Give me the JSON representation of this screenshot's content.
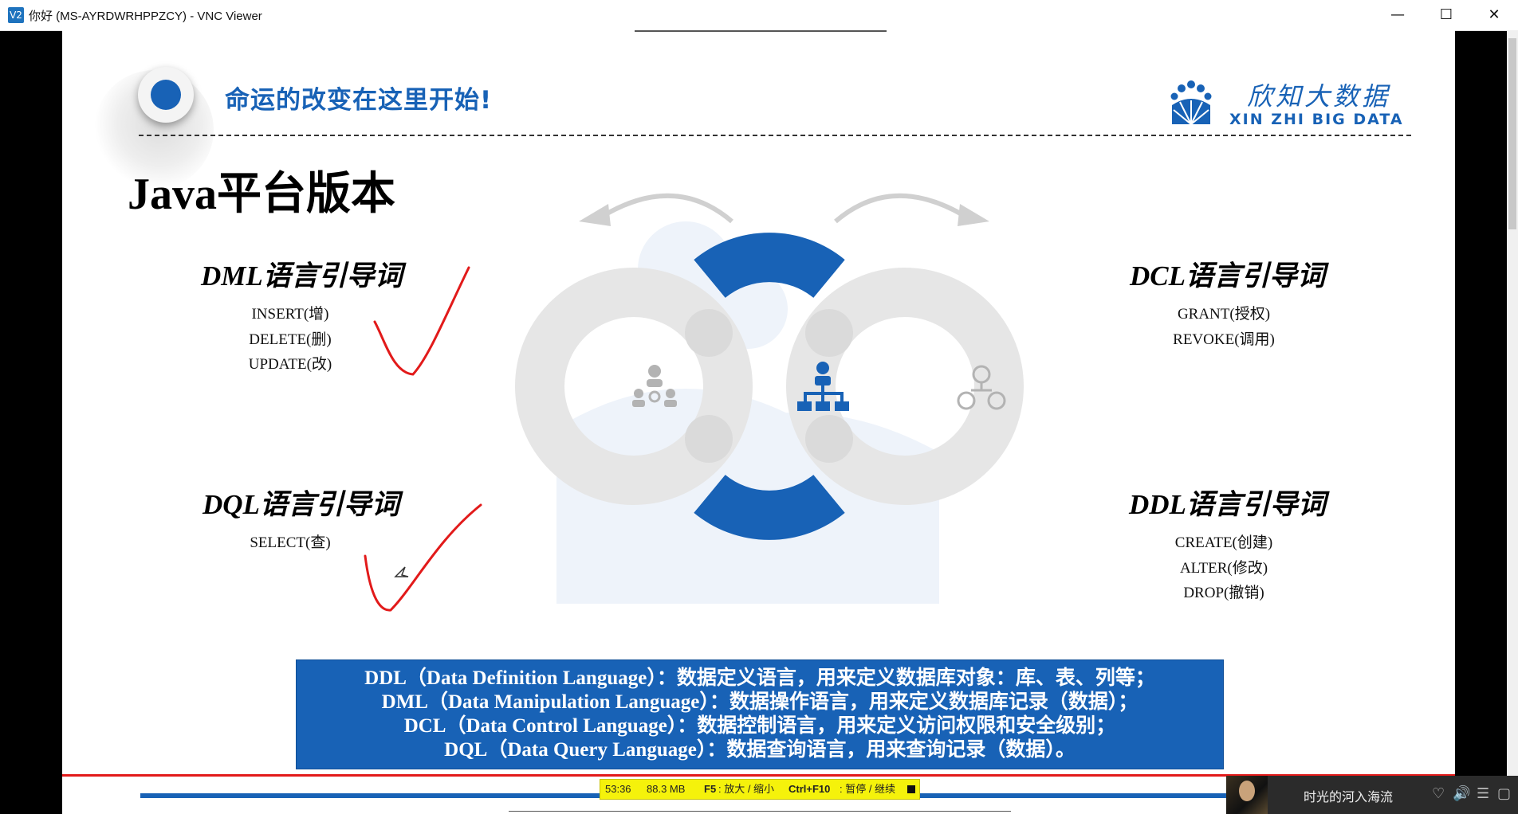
{
  "window": {
    "title": "你好 (MS-AYRDWRHPPZCY) - VNC Viewer",
    "app_icon": "V2",
    "minimize": "—",
    "maximize": "☐",
    "close": "✕"
  },
  "slide": {
    "slogan": "命运的改变在这里开始!",
    "brand_cn": "欣知大数据",
    "brand_en": "XIN ZHI BIG DATA",
    "title": "Java平台版本",
    "dml": {
      "heading": "DML语言引导词",
      "items": [
        "INSERT(增)",
        "DELETE(删)",
        "UPDATE(改)"
      ]
    },
    "dcl": {
      "heading": "DCL语言引导词",
      "items": [
        "GRANT(授权)",
        "REVOKE(调用)"
      ]
    },
    "dql": {
      "heading": "DQL语言引导词",
      "items": [
        "SELECT(查)"
      ]
    },
    "ddl": {
      "heading": "DDL语言引导词",
      "items": [
        "CREATE(创建)",
        "ALTER(修改)",
        "DROP(撤销)"
      ]
    },
    "definitions": [
      "DDL（Data Definition Language）：数据定义语言，用来定义数据库对象：库、表、列等；",
      "DML（Data Manipulation Language）：数据操作语言，用来定义数据库记录（数据）；",
      "DCL（Data Control Language）：数据控制语言，用来定义访问权限和安全级别；",
      "DQL（Data Query Language）：数据查询语言，用来查询记录（数据）。"
    ],
    "colors": {
      "brand_blue": "#1862b6",
      "ink_red": "#e21a1a"
    }
  },
  "status_bar": {
    "time": "53:36",
    "size": "88.3 MB",
    "key1": "F5",
    "hint1": ": 放大 / 缩小",
    "key2": "Ctrl+F10",
    "hint2": ": 暂停 / 继续"
  },
  "music": {
    "song": "时光的河入海流",
    "icons": [
      "heart-icon",
      "volume-icon",
      "playlist-icon",
      "mini-icon"
    ]
  }
}
